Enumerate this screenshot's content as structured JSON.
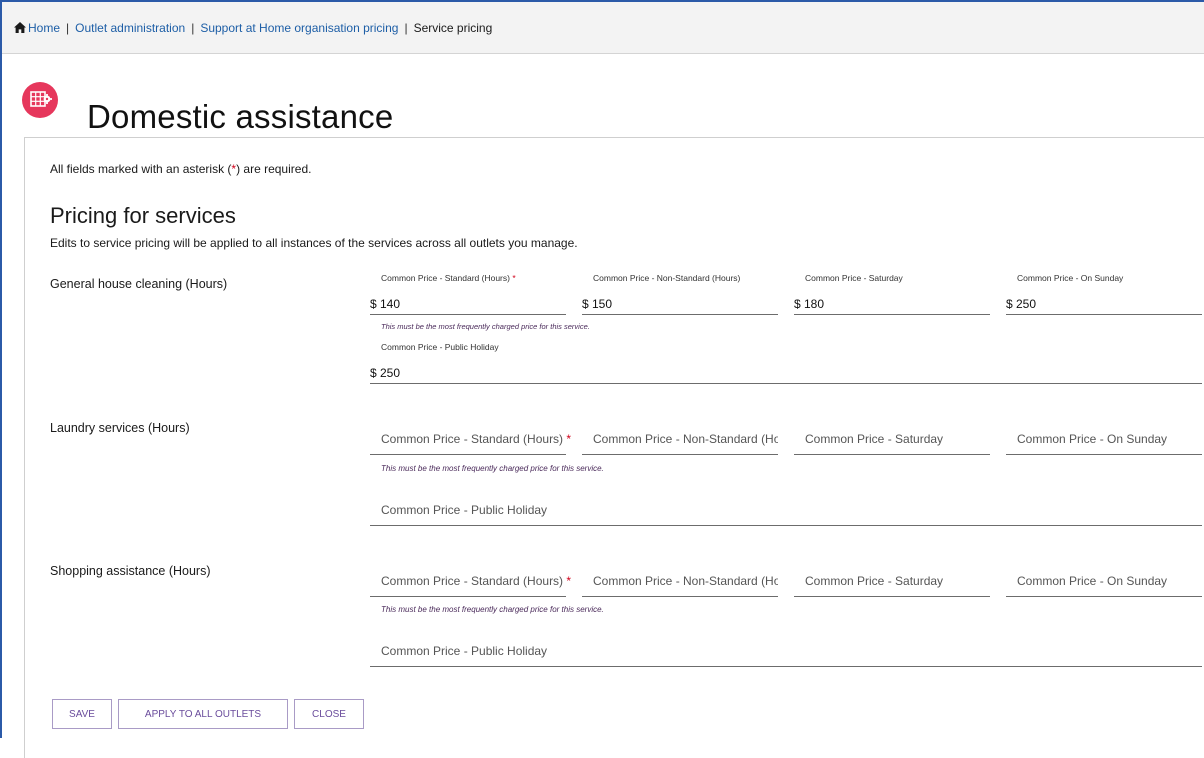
{
  "breadcrumb": {
    "items": [
      "Home",
      "Outlet administration",
      "Support at Home organisation pricing",
      "Service pricing"
    ],
    "separator": "|"
  },
  "page": {
    "title": "Domestic assistance",
    "badge_color": "#e6375c",
    "badge_icon": "grid-gear-icon"
  },
  "form": {
    "required_note_prefix": "All fields marked with an asterisk (",
    "required_star": "*",
    "required_note_suffix": ") are required.",
    "section_title": "Pricing for services",
    "section_subtitle": "Edits to service pricing will be applied to all instances of the services across all outlets you manage.",
    "currency": "$",
    "hint": "This must be the most frequently charged price for this service.",
    "services": [
      {
        "label": "General house cleaning (Hours)",
        "fields": [
          {
            "label": "Common Price - Standard (Hours)",
            "required": true,
            "value": "140"
          },
          {
            "label": "Common Price - Non-Standard (Hours)",
            "required": false,
            "value": "150"
          },
          {
            "label": "Common Price - Saturday",
            "required": false,
            "value": "180"
          },
          {
            "label": "Common Price - On Sunday",
            "required": false,
            "value": "250"
          },
          {
            "label": "Common Price - Public Holiday",
            "required": false,
            "value": "250"
          }
        ]
      },
      {
        "label": "Laundry services (Hours)",
        "fields": [
          {
            "label": "Common Price - Standard (Hours)",
            "required": true,
            "value": ""
          },
          {
            "label": "Common Price - Non-Standard (Hours)",
            "required": false,
            "value": ""
          },
          {
            "label": "Common Price - Saturday",
            "required": false,
            "value": ""
          },
          {
            "label": "Common Price - On Sunday",
            "required": false,
            "value": ""
          },
          {
            "label": "Common Price - Public Holiday",
            "required": false,
            "value": ""
          }
        ]
      },
      {
        "label": "Shopping assistance (Hours)",
        "fields": [
          {
            "label": "Common Price - Standard (Hours)",
            "required": true,
            "value": ""
          },
          {
            "label": "Common Price - Non-Standard (Hours)",
            "required": false,
            "value": ""
          },
          {
            "label": "Common Price - Saturday",
            "required": false,
            "value": ""
          },
          {
            "label": "Common Price - On Sunday",
            "required": false,
            "value": ""
          },
          {
            "label": "Common Price - Public Holiday",
            "required": false,
            "value": ""
          }
        ]
      }
    ]
  },
  "actions": {
    "save": "SAVE",
    "apply_all": "APPLY TO ALL OUTLETS",
    "close": "CLOSE",
    "color": "#6a4c9c"
  }
}
